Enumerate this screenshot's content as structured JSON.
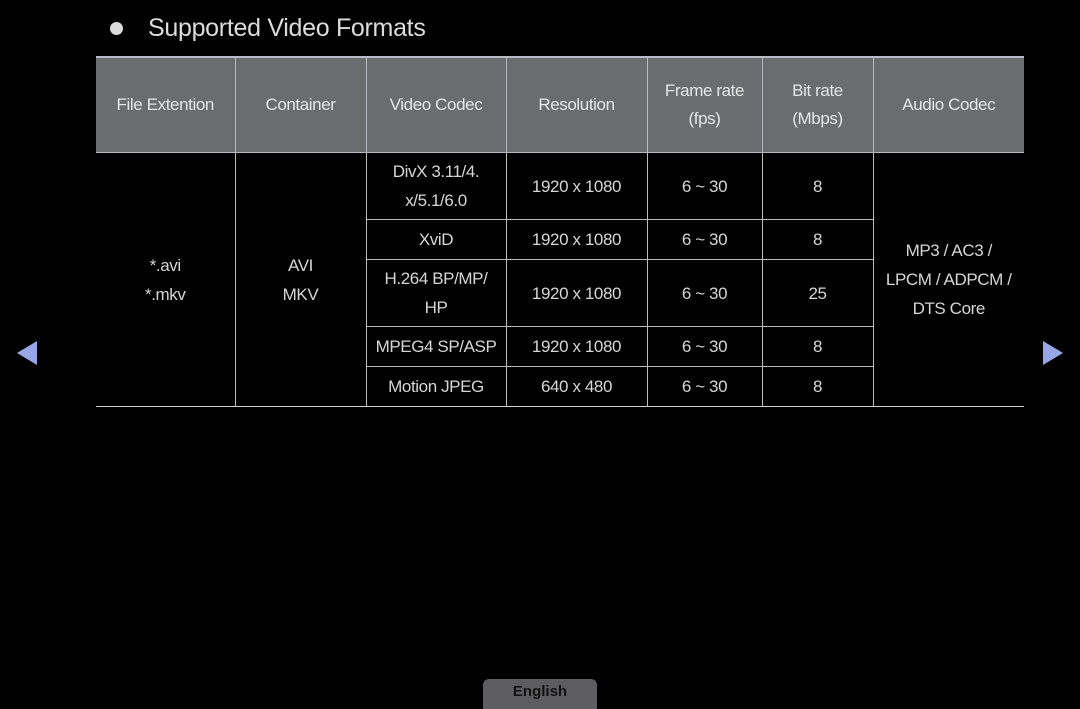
{
  "header": {
    "bullet_icon": "filled-circle",
    "title": "Supported Video Formats"
  },
  "table": {
    "columns": [
      {
        "line1": "File Extention",
        "line2": ""
      },
      {
        "line1": "Container",
        "line2": ""
      },
      {
        "line1": "Video Codec",
        "line2": ""
      },
      {
        "line1": "Resolution",
        "line2": ""
      },
      {
        "line1": "Frame rate",
        "line2": "(fps)"
      },
      {
        "line1": "Bit rate",
        "line2": "(Mbps)"
      },
      {
        "line1": "Audio Codec",
        "line2": ""
      }
    ],
    "file_extensions": [
      "*.avi",
      "*.mkv"
    ],
    "containers": [
      "AVI",
      "MKV"
    ],
    "rows": [
      {
        "codec_line1": "DivX 3.11/4.",
        "codec_line2": "x/5.1/6.0",
        "resolution": "1920 x 1080",
        "frame_rate": "6 ~ 30",
        "bit_rate": "8"
      },
      {
        "codec_line1": "XviD",
        "codec_line2": "",
        "resolution": "1920 x 1080",
        "frame_rate": "6 ~ 30",
        "bit_rate": "8"
      },
      {
        "codec_line1": "H.264 BP/MP/",
        "codec_line2": "HP",
        "resolution": "1920 x 1080",
        "frame_rate": "6 ~ 30",
        "bit_rate": "25"
      },
      {
        "codec_line1": "MPEG4 SP/ASP",
        "codec_line2": "",
        "resolution": "1920 x 1080",
        "frame_rate": "6 ~ 30",
        "bit_rate": "8"
      },
      {
        "codec_line1": "Motion JPEG",
        "codec_line2": "",
        "resolution": "640 x 480",
        "frame_rate": "6 ~ 30",
        "bit_rate": "8"
      }
    ],
    "audio_codec_lines": [
      "MP3 / AC3 /",
      "LPCM / ADPCM /",
      "DTS Core"
    ]
  },
  "navigation": {
    "prev_icon": "triangle-left",
    "next_icon": "triangle-right",
    "arrow_color": "#97a6e6"
  },
  "footer": {
    "language_label": "English"
  }
}
